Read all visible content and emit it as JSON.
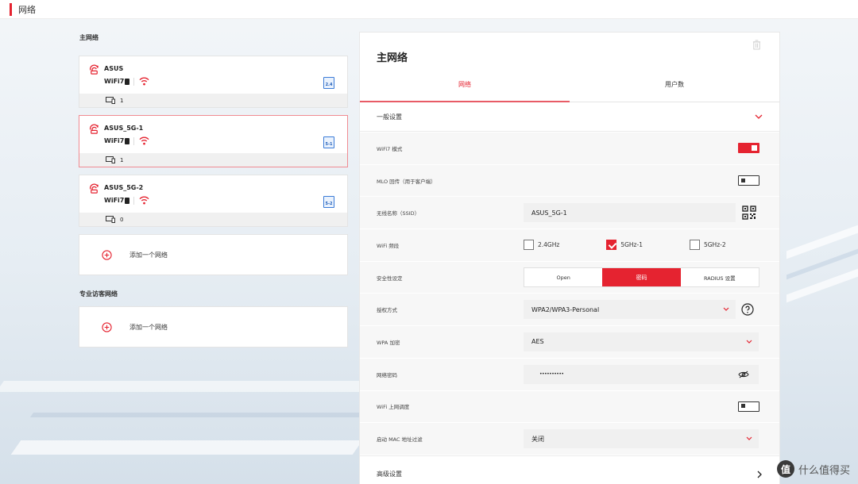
{
  "header": {
    "title": "网络"
  },
  "left": {
    "main_section_label": "主网络",
    "cards": [
      {
        "name": "ASUS",
        "wifi_label": "WiFi7",
        "device_count": "1",
        "band_label": "2.4",
        "selected": false
      },
      {
        "name": "ASUS_5G-1",
        "wifi_label": "WiFi7",
        "device_count": "1",
        "band_label": "5-1",
        "selected": true
      },
      {
        "name": "ASUS_5G-2",
        "wifi_label": "WiFi7",
        "device_count": "0",
        "band_label": "5-2",
        "selected": false
      }
    ],
    "add_network_label": "添加一个网络",
    "pro_section_label": "专业访客网络",
    "pro_add_network_label": "添加一个网络"
  },
  "panel": {
    "title": "主网络",
    "tabs": [
      "网络",
      "用户数"
    ],
    "active_tab": 0,
    "general_settings_label": "一般设置",
    "rows": {
      "wifi7_mode": {
        "label": "WiFi7 模式",
        "enabled": true
      },
      "mlo": {
        "label": "MLO 回传（用于客户端）",
        "enabled": false
      },
      "ssid": {
        "label": "无线名称（SSID）",
        "value": "ASUS_5G-1"
      },
      "band": {
        "label": "WiFi 频段",
        "options": [
          {
            "label": "2.4GHz",
            "checked": false
          },
          {
            "label": "5GHz-1",
            "checked": true
          },
          {
            "label": "5GHz-2",
            "checked": false
          }
        ]
      },
      "security": {
        "label": "安全性设定",
        "options": [
          "Open",
          "密码",
          "RADIUS 设置"
        ],
        "active": 1
      },
      "auth": {
        "label": "授权方式",
        "value": "WPA2/WPA3-Personal"
      },
      "wpa_encryption": {
        "label": "WPA 加密",
        "value": "AES"
      },
      "password": {
        "label": "网络密码",
        "value": "••••••••••"
      },
      "wifi_schedule": {
        "label": "WiFi 上网调度",
        "enabled": false
      },
      "mac_filter": {
        "label": "启动 MAC 地址过滤",
        "value": "关闭"
      }
    },
    "advanced_settings_label": "高级设置"
  },
  "watermark": {
    "badge": "值",
    "text": "什么值得买"
  },
  "colors": {
    "accent": "#e52330",
    "band_icon": "#3b7bd6"
  }
}
